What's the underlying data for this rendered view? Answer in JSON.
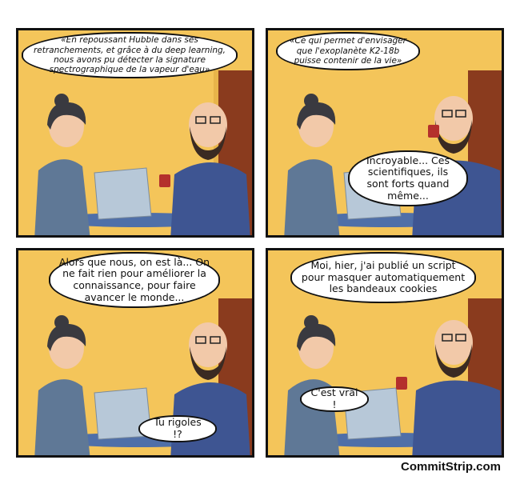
{
  "panels": [
    {
      "speech": "«En repoussant Hubble dans ses retranchements, et grâce à du deep learning, nous avons pu détecter la signature spectrographique de la vapeur d'eau»"
    },
    {
      "speech": "«Ce qui permet d'envisager que l'exoplanète K2-18b puisse contenir de la vie»",
      "reply": "Incroyable... Ces scientifiques, ils sont forts quand même..."
    },
    {
      "speech": "Alors que nous, on est là... On ne fait rien pour améliorer la connaissance, pour faire avancer le monde...",
      "reply": "Tu rigoles !?"
    },
    {
      "speech": "Moi, hier, j'ai publié un script pour masquer automatiquement les bandeaux cookies",
      "reply": "C'est vrai !"
    }
  ],
  "credit": "CommitStrip.com",
  "colors": {
    "wall": "#f4c55a",
    "door": "#8a3b1e",
    "woman_top": "#5f7896",
    "man_shirt": "#3e5592",
    "laptop": "#b7c8d8",
    "table": "#4f6fa8"
  }
}
